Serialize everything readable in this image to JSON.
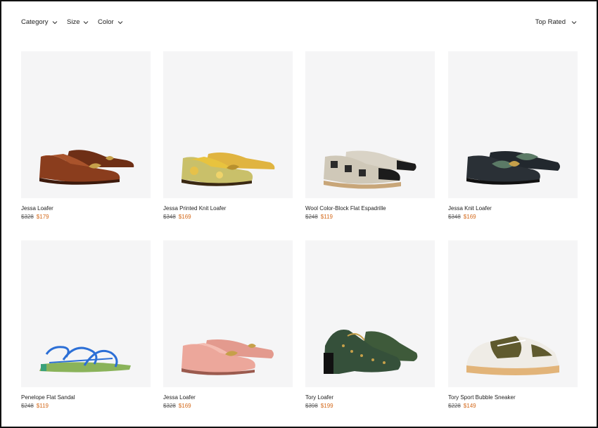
{
  "filters": {
    "category_label": "Category",
    "size_label": "Size",
    "color_label": "Color"
  },
  "sort": {
    "label": "Top Rated"
  },
  "colors": {
    "sale": "#d4691a",
    "image_bg": "#f5f5f6"
  },
  "products": [
    {
      "name": "Jessa Loafer",
      "original_price": "$328",
      "sale_price": "$179"
    },
    {
      "name": "Jessa Printed Knit Loafer",
      "original_price": "$348",
      "sale_price": "$169"
    },
    {
      "name": "Wool Color-Block Flat Espadrille",
      "original_price": "$248",
      "sale_price": "$119"
    },
    {
      "name": "Jessa Knit Loafer",
      "original_price": "$348",
      "sale_price": "$169"
    },
    {
      "name": "Penelope Flat Sandal",
      "original_price": "$248",
      "sale_price": "$119"
    },
    {
      "name": "Jessa Loafer",
      "original_price": "$328",
      "sale_price": "$169"
    },
    {
      "name": "Tory Loafer",
      "original_price": "$398",
      "sale_price": "$199"
    },
    {
      "name": "Tory Sport Bubble Sneaker",
      "original_price": "$228",
      "sale_price": "$149"
    }
  ]
}
